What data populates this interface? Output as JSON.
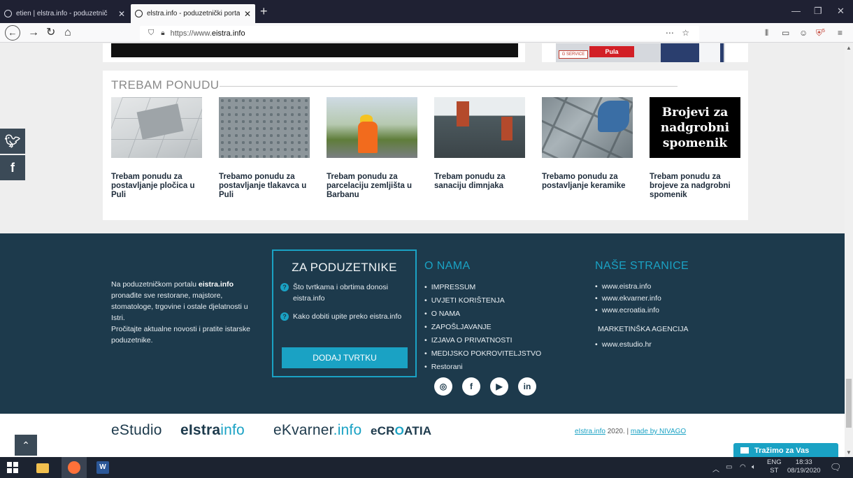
{
  "browser": {
    "tabs": [
      {
        "title": "etien | elstra.info - poduzetnič",
        "active": false
      },
      {
        "title": "elstra.info - poduzetnički porta",
        "active": true
      }
    ],
    "url_prefix": "https://www.",
    "url_domain": "eistra.info",
    "addon_badge": "5"
  },
  "ad": {
    "gservice": "G SERVICE",
    "city": "Pula"
  },
  "offers": {
    "heading": "TREBAM PONUDU",
    "items": [
      {
        "caption": "Trebam ponudu za postavljanje pločica u Puli",
        "image": "tiles-photo"
      },
      {
        "caption": "Trebamo ponudu za postavljanje tlakavca u Puli",
        "image": "pavers-photo"
      },
      {
        "caption": "Trebam ponudu za parcelaciju zemljišta u Barbanu",
        "image": "surveyor-photo"
      },
      {
        "caption": "Trebam ponudu za sanaciju dimnjaka",
        "image": "chimney-photo"
      },
      {
        "caption": "Trebamo ponudu za postavljanje keramike",
        "image": "ceramic-photo"
      },
      {
        "caption": "Trebam ponudu za brojeve za nadgrobni spomenik",
        "image_text": "Brojevi za nadgrobni spomenik"
      }
    ]
  },
  "share": {
    "twitter": "twitter-icon",
    "facebook": "facebook-icon"
  },
  "footer": {
    "about_pre": "Na poduzetničkom portalu ",
    "about_bold": "eistra.info",
    "about_post": " pronađite sve restorane, majstore, stomatologe, trgovine i ostale djelatnosti u Istri.",
    "about_2": "Pročitajte aktualne novosti i pratite istarske poduzetnike.",
    "za": {
      "title": "ZA PODUZETNIKE",
      "q1": "Što tvrtkama i obrtima donosi eistra.info",
      "q2": "Kako dobiti upite preko eistra.info",
      "button": "DODAJ TVRTKU"
    },
    "onama": {
      "title": "O NAMA",
      "items": [
        "IMPRESSUM",
        "UVJETI KORIŠTENJA",
        "O NAMA",
        "ZAPOŠLJAVANJE",
        "IZJAVA O PRIVATNOSTI",
        "MEDIJSKO POKROVITELJSTVO",
        "Restorani"
      ]
    },
    "nase": {
      "title": "NAŠE STRANICE",
      "items": [
        "www.eistra.info",
        "www.ekvarner.info",
        "www.ecroatia.info"
      ],
      "agency_title": "MARKETINŠKA AGENCIJA",
      "agency_items": [
        "www.estudio.hr"
      ]
    },
    "social": [
      "instagram-icon",
      "facebook-icon",
      "youtube-icon",
      "linkedin-icon"
    ]
  },
  "bottom": {
    "logo_estudio": "eStudio",
    "logo_eistra_a": "eIstra",
    "logo_eistra_b": "info",
    "logo_ekvarner_a": "eKvarner",
    "logo_ekvarner_b": ".info",
    "logo_ecroatia_a": "eCR",
    "logo_ecroatia_o": "O",
    "logo_ecroatia_b": "ATIA",
    "copy_link": "eIstra.info",
    "copy_year": "2020.",
    "copy_sep": "|",
    "copy_made": "made by NIVAGO"
  },
  "chat": {
    "label": "Tražimo za Vas"
  },
  "taskbar": {
    "lang_1": "ENG",
    "lang_2": "ST",
    "time": "18:33",
    "date": "08/19/2020"
  }
}
